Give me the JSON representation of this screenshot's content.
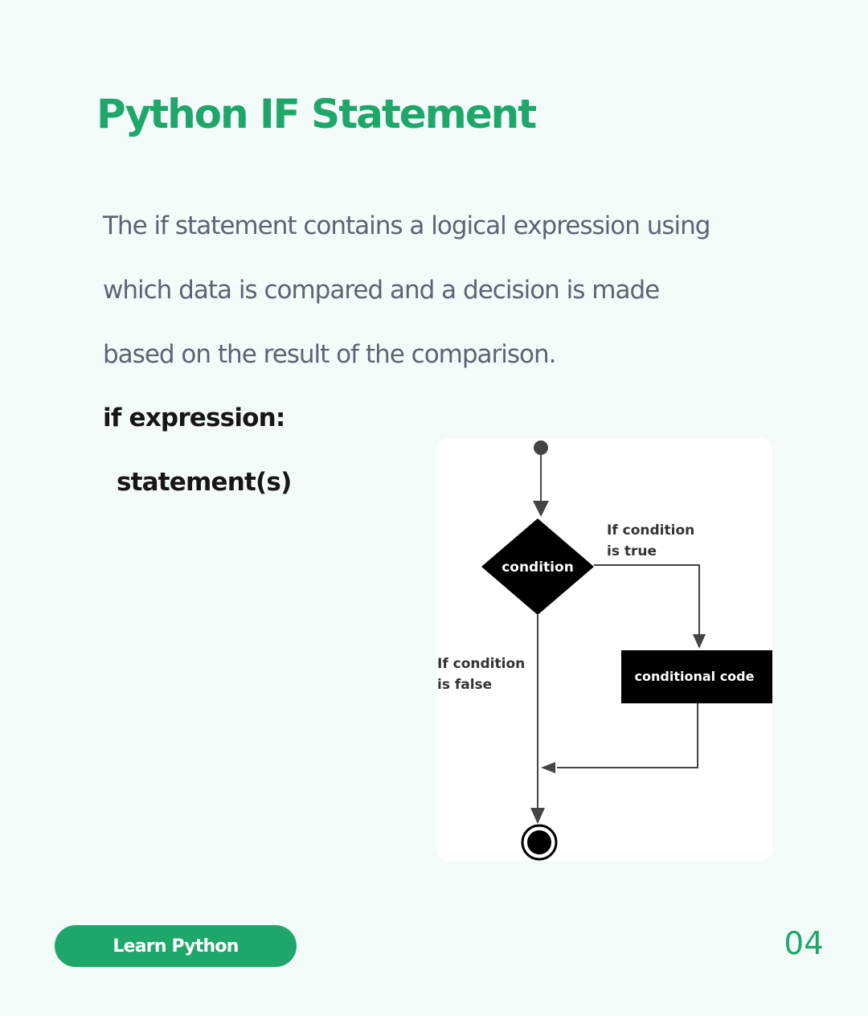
{
  "page": {
    "title": "Python IF Statement",
    "description_lines": [
      "The if statement contains a logical expression using",
      "which data is compared and a decision is made",
      "based on the result of the comparison."
    ],
    "code_lines": [
      "if expression:",
      "statement(s)"
    ]
  },
  "diagram": {
    "decision_label": "condition",
    "true_label_lines": [
      "If condition",
      "is true"
    ],
    "false_label_lines": [
      "If condition",
      "is false"
    ],
    "process_label": "conditional code"
  },
  "footer": {
    "pill_label": "Learn Python",
    "page_number": "04"
  },
  "colors": {
    "brand_green": "#1fa66a",
    "background": "#f3fcf9",
    "body_text": "#5d6373",
    "code_text": "#161616"
  }
}
